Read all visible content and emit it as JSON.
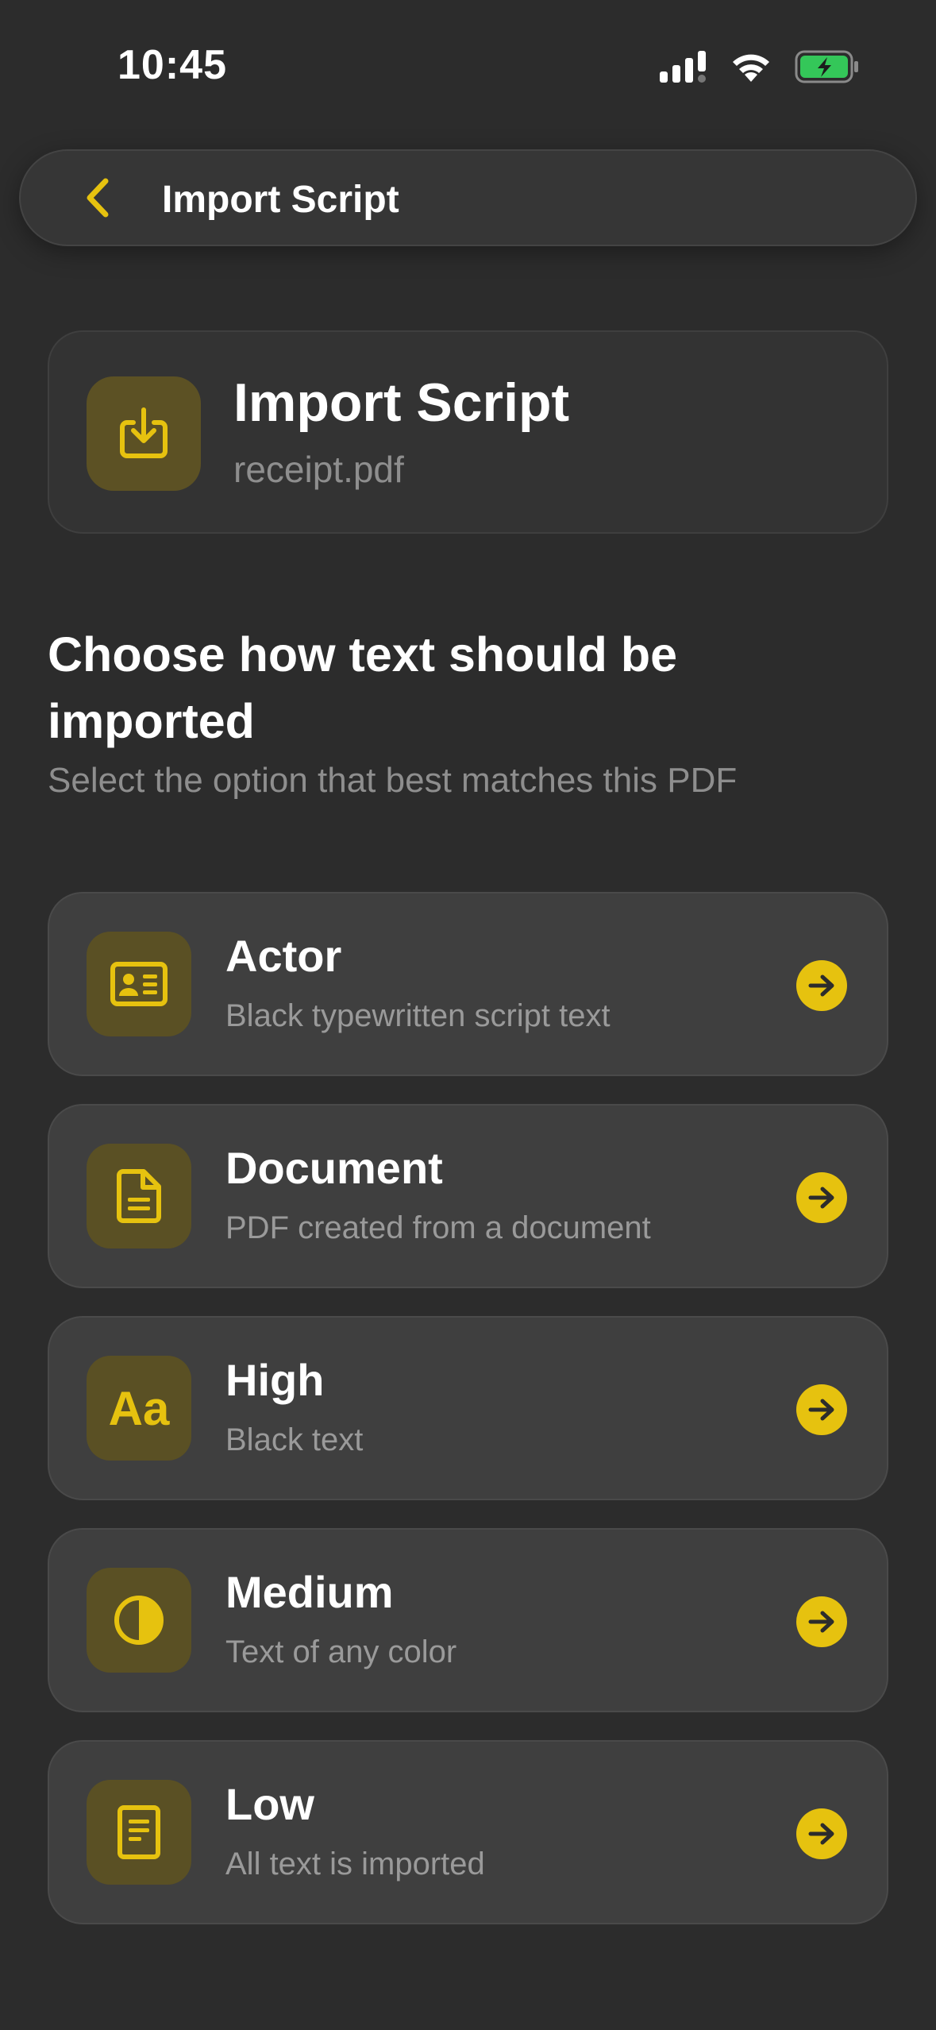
{
  "status_bar": {
    "time": "10:45"
  },
  "nav": {
    "title": "Import Script"
  },
  "header": {
    "title": "Import Script",
    "filename": "receipt.pdf"
  },
  "section": {
    "title": "Choose how text should be imported",
    "subtitle": "Select the option that best matches this PDF"
  },
  "options": [
    {
      "title": "Actor",
      "description": "Black typewritten script text",
      "icon": "id-card-icon"
    },
    {
      "title": "Document",
      "description": "PDF created from a document",
      "icon": "document-icon"
    },
    {
      "title": "High",
      "description": "Black text",
      "icon": "text-aa-icon",
      "icon_text": "Aa"
    },
    {
      "title": "Medium",
      "description": "Text of any color",
      "icon": "half-circle-contrast-icon"
    },
    {
      "title": "Low",
      "description": "All text is imported",
      "icon": "note-icon"
    }
  ],
  "colors": {
    "accent": "#e6c20f",
    "background": "#2c2c2c",
    "card": "#3f3f3f",
    "battery": "#34c759"
  }
}
